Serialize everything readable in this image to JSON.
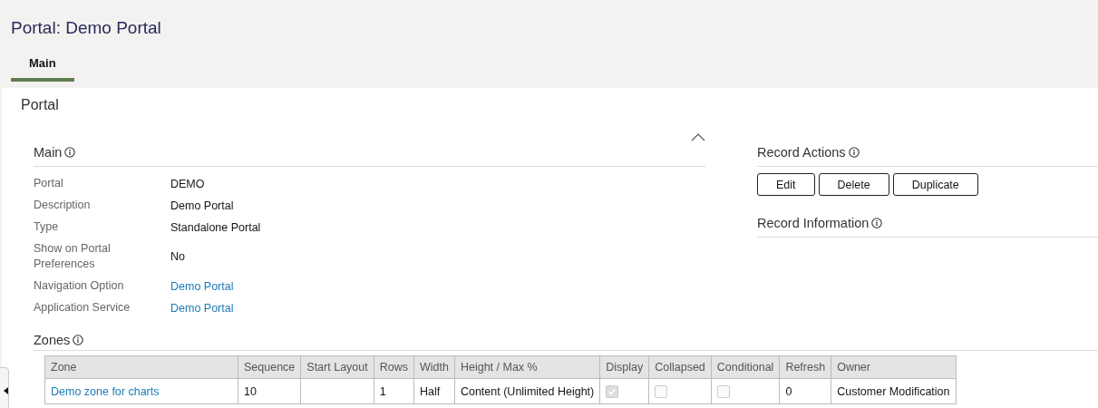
{
  "page": {
    "title": "Portal: Demo Portal"
  },
  "tabs": [
    {
      "label": "Main",
      "selected": true
    }
  ],
  "section_title": "Portal",
  "main": {
    "title": "Main",
    "expanded": true,
    "fields": [
      {
        "label": "Portal",
        "value": "DEMO",
        "kind": "text"
      },
      {
        "label": "Description",
        "value": "Demo Portal",
        "kind": "text"
      },
      {
        "label": "Type",
        "value": "Standalone Portal",
        "kind": "text"
      },
      {
        "label": "Show on Portal Preferences",
        "value": "No",
        "kind": "text"
      },
      {
        "label": "Navigation Option",
        "value": "Demo Portal",
        "kind": "link"
      },
      {
        "label": "Application Service",
        "value": "Demo Portal",
        "kind": "link"
      }
    ]
  },
  "record_actions": {
    "title": "Record Actions",
    "buttons": [
      "Edit",
      "Delete",
      "Duplicate"
    ]
  },
  "record_information": {
    "title": "Record Information"
  },
  "zones": {
    "title": "Zones",
    "columns": [
      "Zone",
      "Sequence",
      "Start Layout",
      "Rows",
      "Width",
      "Height / Max %",
      "Display",
      "Collapsed",
      "Conditional",
      "Refresh",
      "Owner"
    ],
    "rows": [
      {
        "zone": "Demo zone for charts",
        "sequence": "10",
        "rows": "1",
        "width": "Half",
        "height": "Content (Unlimited Height)",
        "display": {
          "checked": true,
          "disabled": true
        },
        "collapsed": {
          "checked": false,
          "disabled": true
        },
        "conditional": {
          "checked": false,
          "disabled": true
        },
        "refresh": "0",
        "owner": "Customer Modification"
      }
    ]
  }
}
